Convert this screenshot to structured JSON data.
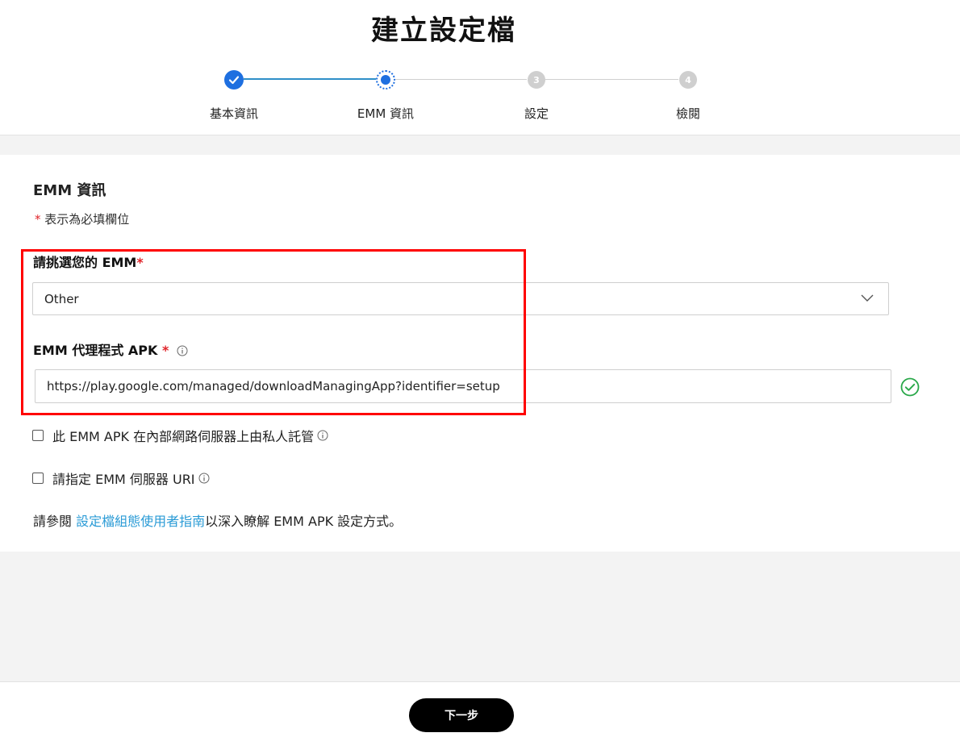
{
  "page": {
    "title": "建立設定檔"
  },
  "stepper": {
    "steps": [
      {
        "label": "基本資訊",
        "state": "done",
        "number": "1"
      },
      {
        "label": "EMM 資訊",
        "state": "current",
        "number": "2"
      },
      {
        "label": "設定",
        "state": "todo",
        "number": "3"
      },
      {
        "label": "檢閱",
        "state": "todo",
        "number": "4"
      }
    ]
  },
  "form": {
    "section_title": "EMM 資訊",
    "required_mark": "*",
    "required_note": "表示為必填欄位",
    "emm_select": {
      "label": "請挑選您的 EMM",
      "value": "Other"
    },
    "apk_field": {
      "label": "EMM 代理程式 APK",
      "value": "https://play.google.com/managed/downloadManagingApp?identifier=setup",
      "status": "valid"
    },
    "checkboxes": [
      {
        "label": "此 EMM APK 在內部網路伺服器上由私人託管",
        "checked": false
      },
      {
        "label": "請指定 EMM 伺服器 URI",
        "checked": false
      }
    ],
    "guide": {
      "prefix": "請參閱 ",
      "link_text": "設定檔組態使用者指南",
      "suffix": "以深入瞭解 EMM APK 設定方式。"
    }
  },
  "footer": {
    "next_label": "下一步"
  },
  "colors": {
    "accent": "#1e6fe0",
    "link": "#2a9bd6",
    "required": "#e0242a",
    "valid": "#2aa84a",
    "highlight": "#ff0000"
  }
}
